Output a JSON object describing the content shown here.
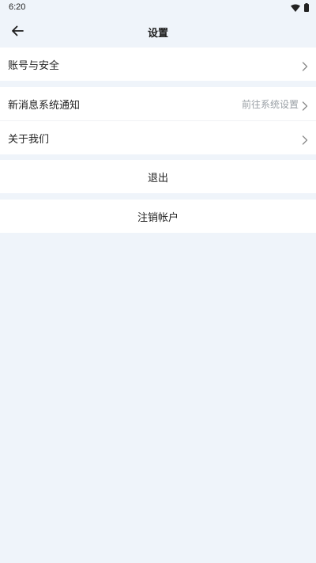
{
  "status_bar": {
    "time": "6:20",
    "icons": [
      "wifi-icon",
      "battery-icon"
    ]
  },
  "header": {
    "title": "设置",
    "back_icon": "arrow-left-icon"
  },
  "sections": {
    "account": {
      "label": "账号与安全"
    },
    "notifications": {
      "label": "新消息系统通知",
      "hint": "前往系统设置"
    },
    "about": {
      "label": "关于我们"
    },
    "logout": {
      "label": "退出"
    },
    "delete_account": {
      "label": "注销帐户"
    }
  },
  "colors": {
    "background": "#eff4fa",
    "card": "#ffffff",
    "text": "#222222",
    "hint": "#9aa0a6"
  }
}
